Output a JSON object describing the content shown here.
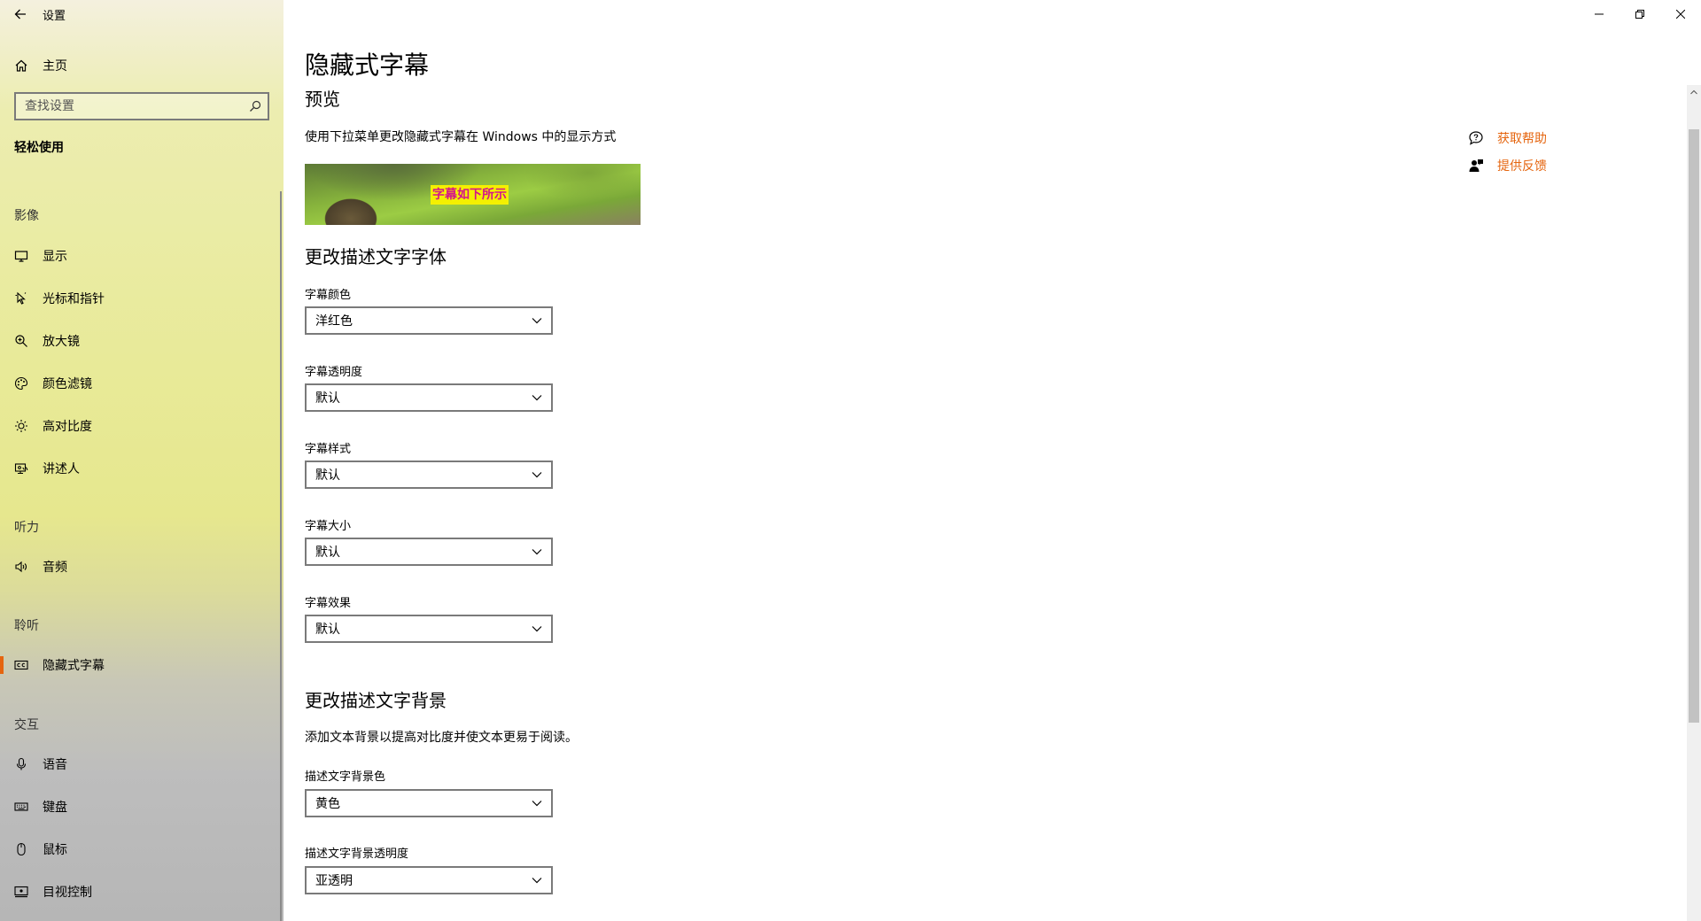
{
  "app": {
    "title": "设置"
  },
  "sidebar": {
    "home_label": "主页",
    "search_placeholder": "查找设置",
    "category": "轻松使用",
    "groups": [
      {
        "title": "影像",
        "items": [
          {
            "label": "显示",
            "icon": "monitor-icon"
          },
          {
            "label": "光标和指针",
            "icon": "cursor-icon"
          },
          {
            "label": "放大镜",
            "icon": "magnifier-icon"
          },
          {
            "label": "颜色滤镜",
            "icon": "palette-icon"
          },
          {
            "label": "高对比度",
            "icon": "contrast-icon"
          },
          {
            "label": "讲述人",
            "icon": "narrator-icon"
          }
        ]
      },
      {
        "title": "听力",
        "items": [
          {
            "label": "音频",
            "icon": "speaker-icon"
          }
        ]
      },
      {
        "title": "聆听",
        "items": [
          {
            "label": "隐藏式字幕",
            "icon": "closed-caption-icon",
            "selected": true
          }
        ]
      },
      {
        "title": "交互",
        "items": [
          {
            "label": "语音",
            "icon": "microphone-icon"
          },
          {
            "label": "键盘",
            "icon": "keyboard-icon"
          },
          {
            "label": "鼠标",
            "icon": "mouse-icon"
          },
          {
            "label": "目视控制",
            "icon": "eye-control-icon"
          }
        ]
      }
    ]
  },
  "main": {
    "page_title": "隐藏式字幕",
    "preview_title": "预览",
    "preview_desc": "使用下拉菜单更改隐藏式字幕在 Windows 中的显示方式",
    "preview_caption": "字幕如下所示",
    "font_section_title": "更改描述文字字体",
    "font_fields": [
      {
        "label": "字幕颜色",
        "value": "洋红色"
      },
      {
        "label": "字幕透明度",
        "value": "默认"
      },
      {
        "label": "字幕样式",
        "value": "默认"
      },
      {
        "label": "字幕大小",
        "value": "默认"
      },
      {
        "label": "字幕效果",
        "value": "默认"
      }
    ],
    "bg_section_title": "更改描述文字背景",
    "bg_desc": "添加文本背景以提高对比度并使文本更易于阅读。",
    "bg_fields": [
      {
        "label": "描述文字背景色",
        "value": "黄色"
      },
      {
        "label": "描述文字背景透明度",
        "value": "亚透明"
      }
    ]
  },
  "help": {
    "get_help": "获取帮助",
    "feedback": "提供反馈"
  },
  "colors": {
    "accent": "#e5650f",
    "caption_text": "#d4148c",
    "caption_bg": "#f4f000"
  }
}
